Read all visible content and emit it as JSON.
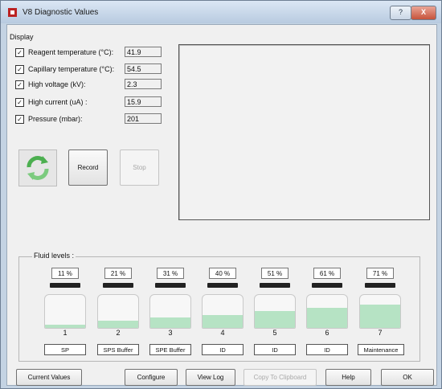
{
  "window": {
    "title": "V8 Diagnostic Values",
    "help_label": "?",
    "close_label": "X"
  },
  "display": {
    "group_label": "Display",
    "items": [
      {
        "label": "Reagent temperature (°C):",
        "checked": true,
        "value": "41.9"
      },
      {
        "label": "Capillary temperature (°C):",
        "checked": true,
        "value": "54.5"
      },
      {
        "label": "High voltage (kV):",
        "checked": true,
        "value": "2.3"
      },
      {
        "label": "High current (uA) :",
        "checked": true,
        "value": "15.9"
      },
      {
        "label": "Pressure (mbar):",
        "checked": true,
        "value": "201"
      }
    ]
  },
  "actions": {
    "record_label": "Record",
    "stop_label": "Stop"
  },
  "fluid_levels": {
    "group_label": "Fluid levels :",
    "fill_color": "#b6e3c4",
    "items": [
      {
        "percent_text": "11 %",
        "level": 0.11,
        "number": "1",
        "name": "SP"
      },
      {
        "percent_text": "21 %",
        "level": 0.21,
        "number": "2",
        "name": "SPS Buffer"
      },
      {
        "percent_text": "31 %",
        "level": 0.31,
        "number": "3",
        "name": "SPE Buffer"
      },
      {
        "percent_text": "40 %",
        "level": 0.4,
        "number": "4",
        "name": "ID"
      },
      {
        "percent_text": "51 %",
        "level": 0.51,
        "number": "5",
        "name": "ID"
      },
      {
        "percent_text": "61 %",
        "level": 0.61,
        "number": "6",
        "name": "ID"
      },
      {
        "percent_text": "71 %",
        "level": 0.71,
        "number": "7",
        "name": "Maintenance"
      }
    ]
  },
  "bottom_bar": {
    "current_values_label": "Current Values",
    "configure_label": "Configure",
    "view_log_label": "View Log",
    "copy_label": "Copy To Clipboard",
    "help_label": "Help",
    "ok_label": "OK"
  }
}
